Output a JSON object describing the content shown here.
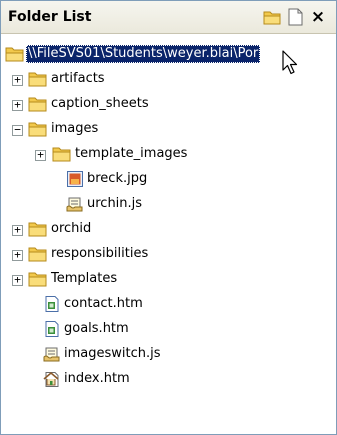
{
  "panel": {
    "title": "Folder List",
    "buttons": {
      "new_folder": "new-folder-icon",
      "new_file": "new-page-icon",
      "close": "×"
    }
  },
  "tree": {
    "root": "\\\\FileSVS01\\Students\\weyer.blai\\Por",
    "items": [
      {
        "label": "artifacts",
        "expander": "+"
      },
      {
        "label": "caption_sheets",
        "expander": "+"
      },
      {
        "label": "images",
        "expander": "−"
      },
      {
        "label": "template_images",
        "expander": "+"
      },
      {
        "label": "breck.jpg"
      },
      {
        "label": "urchin.js"
      },
      {
        "label": "orchid",
        "expander": "+"
      },
      {
        "label": "responsibilities",
        "expander": "+"
      },
      {
        "label": "Templates",
        "expander": "+"
      },
      {
        "label": "contact.htm"
      },
      {
        "label": "goals.htm"
      },
      {
        "label": "imageswitch.js"
      },
      {
        "label": "index.htm"
      }
    ]
  },
  "colors": {
    "selection": "#0a246a",
    "folder": "#f2c94c",
    "border": "#7f9db9"
  }
}
